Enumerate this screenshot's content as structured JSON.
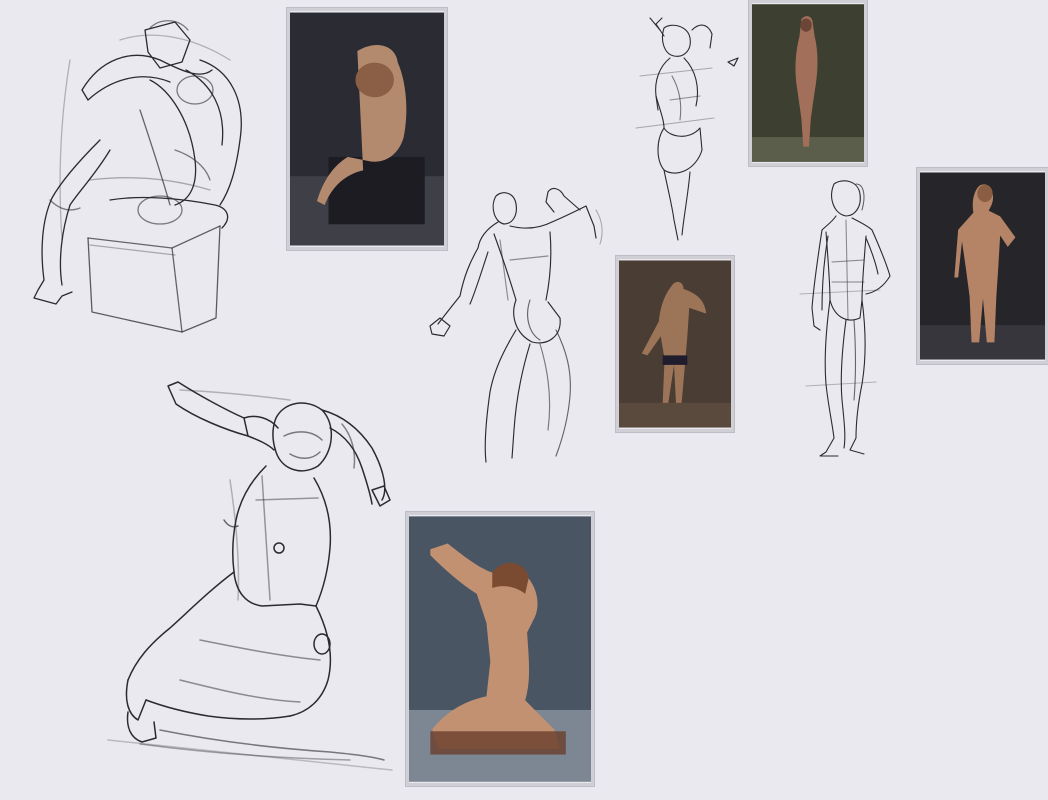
{
  "canvas": {
    "background": "#e9e9ef",
    "ink_color": "#2b2b2f"
  },
  "reference_photos": [
    {
      "name": "reference-photo-crouched-on-block",
      "background": "#2a2b33",
      "floor": "#3e3f47",
      "skin": "#b48a6e"
    },
    {
      "name": "reference-photo-standing-arms-up",
      "background": "#3d4031",
      "floor": "#5b5e4a",
      "skin": "#a2705a"
    },
    {
      "name": "reference-photo-standing-back-view",
      "background": "#4a3d33",
      "floor": "#5a4a3e",
      "skin": "#9c7458"
    },
    {
      "name": "reference-photo-standing-hand-on-hip",
      "background": "#26262a",
      "floor": "#36363c",
      "skin": "#b58467"
    },
    {
      "name": "reference-photo-kneeling-arms-raised",
      "background": "#4a5564",
      "floor": "#7d8794",
      "skin": "#c29172"
    }
  ],
  "tool_cursor": {
    "icon": "triangle-cursor-icon"
  }
}
